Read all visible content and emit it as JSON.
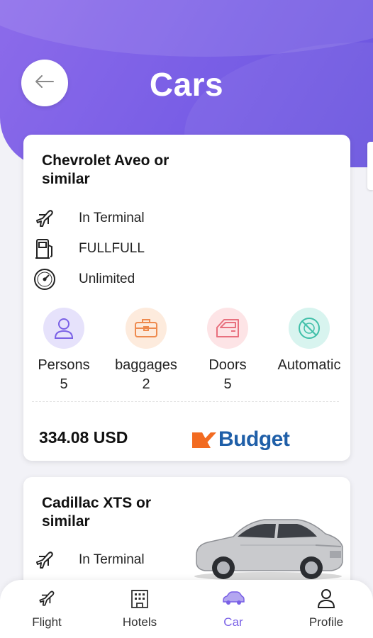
{
  "header": {
    "title": "Cars",
    "back_icon": "arrow-left-icon",
    "gradient_start": "#8c6bea",
    "gradient_end": "#6a55df"
  },
  "cars": [
    {
      "name": "Chevrolet Aveo or similar",
      "features": [
        {
          "icon": "airplane-icon",
          "label": "In Terminal"
        },
        {
          "icon": "fuel-pump-icon",
          "label": "FULLFULL"
        },
        {
          "icon": "speedometer-icon",
          "label": "Unlimited"
        }
      ],
      "specs": [
        {
          "icon": "person-icon",
          "label": "Persons",
          "value": "5",
          "bg": "#e6e2fb",
          "color": "#7a61e6"
        },
        {
          "icon": "briefcase-icon",
          "label": "baggages",
          "value": "2",
          "bg": "#fdebdd",
          "color": "#ee8a4e"
        },
        {
          "icon": "car-door-icon",
          "label": "Doors",
          "value": "5",
          "bg": "#fde4e6",
          "color": "#e8707e"
        },
        {
          "icon": "no-auto-icon",
          "label": "Automatic",
          "value": "",
          "bg": "#d8f4ef",
          "color": "#3fbfa8"
        }
      ],
      "price": "334.08 USD",
      "vendor": "Budget"
    },
    {
      "name": "Cadillac XTS or similar",
      "features": [
        {
          "icon": "airplane-icon",
          "label": "In Terminal"
        }
      ]
    }
  ],
  "nav": {
    "items": [
      {
        "icon": "airplane-icon",
        "label": "Flight"
      },
      {
        "icon": "hotel-icon",
        "label": "Hotels"
      },
      {
        "icon": "car-icon",
        "label": "Car"
      },
      {
        "icon": "user-icon",
        "label": "Profile"
      }
    ],
    "active": "Car",
    "active_color": "#7a61e6"
  }
}
